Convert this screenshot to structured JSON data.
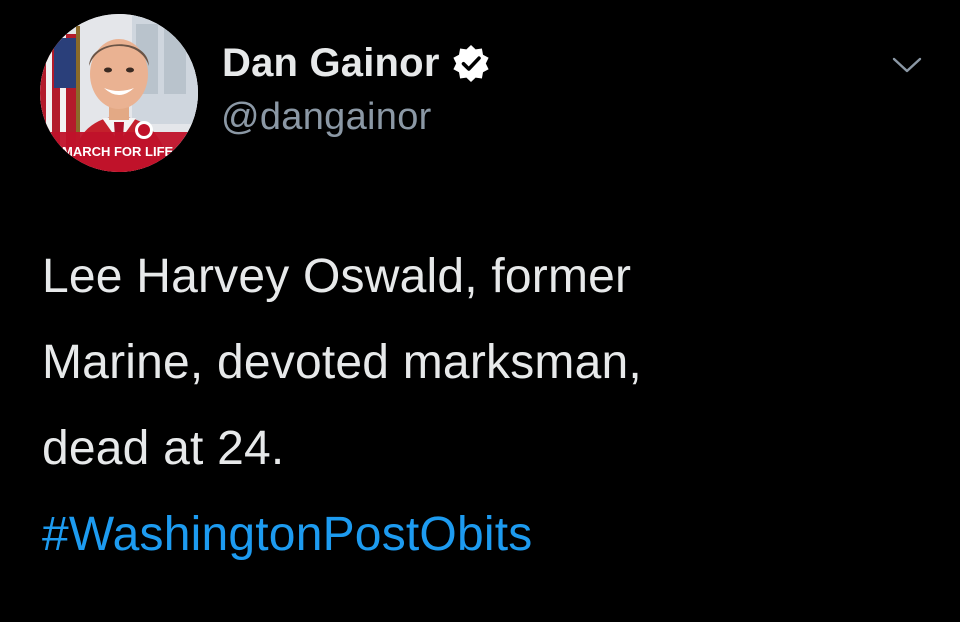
{
  "author": {
    "display_name": "Dan Gainor",
    "handle": "@dangainor",
    "verified": true,
    "avatar_caption": "MARCH FOR LIFE"
  },
  "tweet": {
    "lines": [
      "Lee Harvey Oswald, former",
      "Marine, devoted marksman,",
      "dead at 24."
    ],
    "hashtag": "#WashingtonPostObits"
  },
  "icons": {
    "verified": "verified-badge-icon",
    "menu": "chevron-down-icon"
  },
  "colors": {
    "background": "#000000",
    "text": "#e7e9ea",
    "secondary_text": "#8b98a5",
    "link": "#1d9bf0",
    "avatar_ring": "#c0122a"
  }
}
